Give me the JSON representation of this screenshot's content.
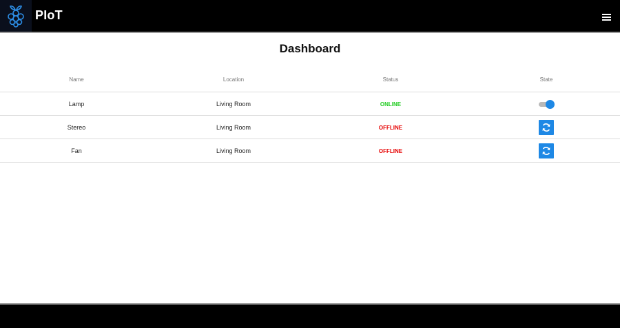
{
  "header": {
    "brand": "PIoT",
    "logo_icon": "raspberry-pi-icon",
    "menu_icon": "hamburger-menu-icon"
  },
  "main": {
    "title": "Dashboard",
    "columns": {
      "name": "Name",
      "location": "Location",
      "status": "Status",
      "state": "State"
    },
    "devices": [
      {
        "name": "Lamp",
        "location": "Living Room",
        "status": "ONLINE",
        "state_control": "toggle",
        "toggle_on": true
      },
      {
        "name": "Stereo",
        "location": "Living Room",
        "status": "OFFLINE",
        "state_control": "refresh-button"
      },
      {
        "name": "Fan",
        "location": "Living Room",
        "status": "OFFLINE",
        "state_control": "refresh-button"
      }
    ]
  },
  "colors": {
    "header_bg": "#000000",
    "accent": "#1e88e5",
    "online": "#22cc22",
    "offline": "#e60000"
  }
}
